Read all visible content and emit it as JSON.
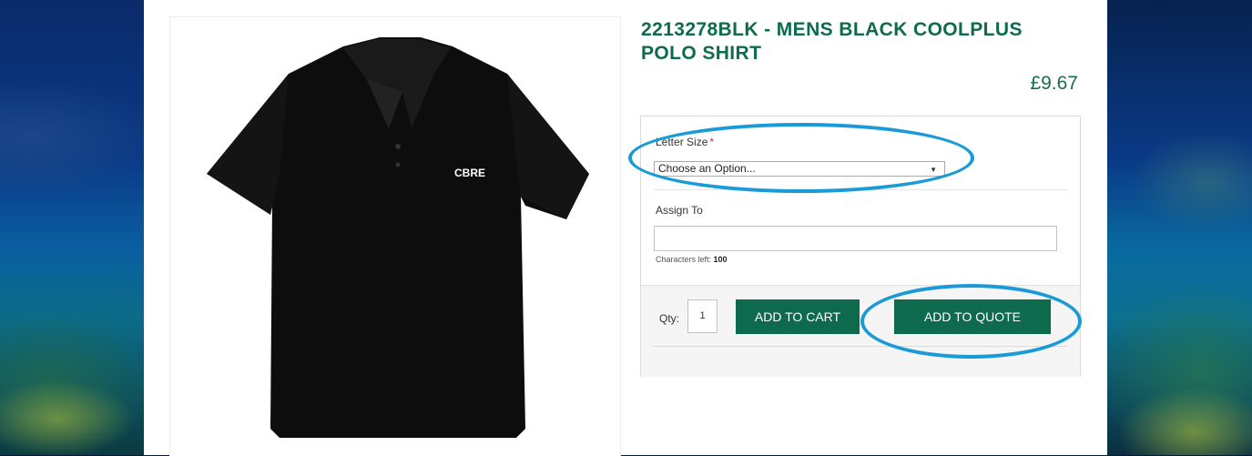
{
  "product": {
    "title": "2213278BLK - MENS BLACK COOLPLUS POLO SHIRT",
    "price": "£9.67",
    "image_logo_text": "CBRE",
    "image_alt_icon": "black-polo-shirt"
  },
  "options": {
    "size_label": "Letter Size",
    "required_marker": "*",
    "size_select_value": "Choose an Option...",
    "assign_label": "Assign To",
    "assign_value": "",
    "chars_left_label": "Characters left:",
    "chars_left_count": "100"
  },
  "actions": {
    "qty_label": "Qty:",
    "qty_value": "1",
    "add_to_cart": "ADD TO CART",
    "add_to_quote": "ADD TO QUOTE"
  },
  "colors": {
    "brand_green": "#0e6a4c",
    "annotation_blue": "#1a9ad6"
  }
}
